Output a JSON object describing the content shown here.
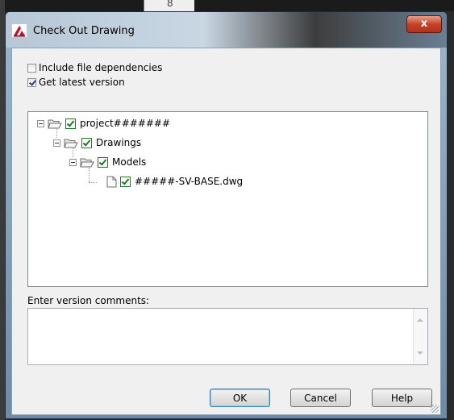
{
  "dialog": {
    "title": "Check Out Drawing",
    "close_symbol": "x"
  },
  "options": {
    "include_dependencies": {
      "label": "Include file dependencies",
      "checked": false
    },
    "get_latest": {
      "label": "Get latest version",
      "checked": true
    }
  },
  "tree": {
    "nodes": [
      {
        "label": "project#######",
        "level": 0,
        "checked": true,
        "type": "folder"
      },
      {
        "label": "Drawings",
        "level": 1,
        "checked": true,
        "type": "folder"
      },
      {
        "label": "Models",
        "level": 2,
        "checked": true,
        "type": "folder"
      },
      {
        "label": "#####-SV-BASE.dwg",
        "level": 3,
        "checked": true,
        "type": "file"
      }
    ]
  },
  "comments": {
    "label": "Enter version comments:",
    "value": ""
  },
  "buttons": {
    "ok": "OK",
    "cancel": "Cancel",
    "help": "Help"
  },
  "icons": {
    "app": "autocad-app-icon",
    "folder": "open-folder-icon",
    "file": "document-icon",
    "expander": "tree-collapse-icon"
  }
}
